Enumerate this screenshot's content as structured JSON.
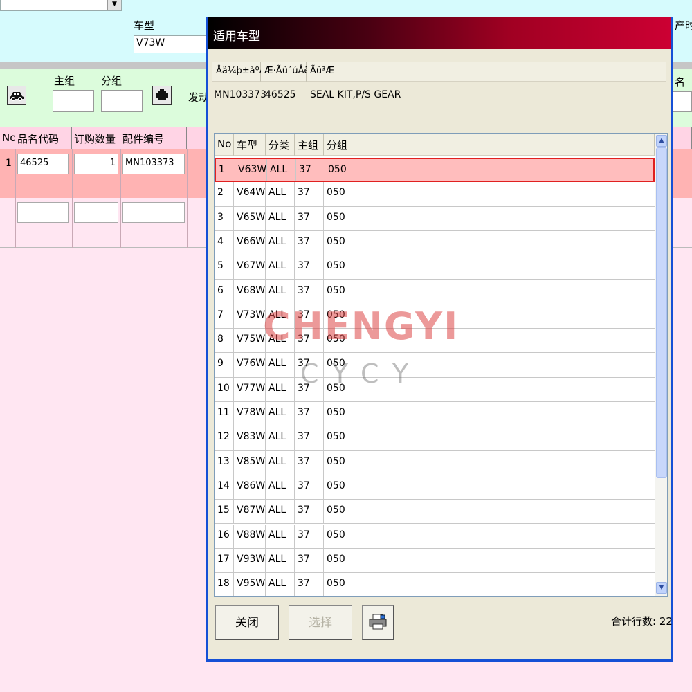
{
  "main": {
    "model_label": "车型",
    "model_value": "V73W",
    "prod_label_partial": "产时",
    "main_group_label": "主组",
    "sub_group_label": "分组",
    "engine_label_partial": "发动",
    "name_label_partial": "名",
    "grid": {
      "headers": [
        "No",
        "品名代码",
        "订购数量",
        "配件编号"
      ],
      "row": {
        "no": "1",
        "code": "46525",
        "qty": "1",
        "part": "MN103373"
      }
    }
  },
  "dialog": {
    "title": "适用车型",
    "info_headers": [
      "Åä¼þ±àºÅ",
      "Æ·Ãû´úÂë",
      "Ãû³Æ"
    ],
    "info_values": {
      "part_no": "MN103373",
      "code": "46525",
      "name": "SEAL KIT,P/S GEAR"
    },
    "list_headers": [
      "No",
      "车型",
      "分类",
      "主组",
      "分组"
    ],
    "rows": [
      {
        "no": "1",
        "model": "V63W",
        "cls": "ALL",
        "main": "37",
        "sub": "050"
      },
      {
        "no": "2",
        "model": "V64W",
        "cls": "ALL",
        "main": "37",
        "sub": "050"
      },
      {
        "no": "3",
        "model": "V65W",
        "cls": "ALL",
        "main": "37",
        "sub": "050"
      },
      {
        "no": "4",
        "model": "V66W",
        "cls": "ALL",
        "main": "37",
        "sub": "050"
      },
      {
        "no": "5",
        "model": "V67W",
        "cls": "ALL",
        "main": "37",
        "sub": "050"
      },
      {
        "no": "6",
        "model": "V68W",
        "cls": "ALL",
        "main": "37",
        "sub": "050"
      },
      {
        "no": "7",
        "model": "V73W",
        "cls": "ALL",
        "main": "37",
        "sub": "050"
      },
      {
        "no": "8",
        "model": "V75W",
        "cls": "ALL",
        "main": "37",
        "sub": "050"
      },
      {
        "no": "9",
        "model": "V76W",
        "cls": "ALL",
        "main": "37",
        "sub": "050"
      },
      {
        "no": "10",
        "model": "V77W",
        "cls": "ALL",
        "main": "37",
        "sub": "050"
      },
      {
        "no": "11",
        "model": "V78W",
        "cls": "ALL",
        "main": "37",
        "sub": "050"
      },
      {
        "no": "12",
        "model": "V83W",
        "cls": "ALL",
        "main": "37",
        "sub": "050"
      },
      {
        "no": "13",
        "model": "V85W",
        "cls": "ALL",
        "main": "37",
        "sub": "050"
      },
      {
        "no": "14",
        "model": "V86W",
        "cls": "ALL",
        "main": "37",
        "sub": "050"
      },
      {
        "no": "15",
        "model": "V87W",
        "cls": "ALL",
        "main": "37",
        "sub": "050"
      },
      {
        "no": "16",
        "model": "V88W",
        "cls": "ALL",
        "main": "37",
        "sub": "050"
      },
      {
        "no": "17",
        "model": "V93W",
        "cls": "ALL",
        "main": "37",
        "sub": "050"
      },
      {
        "no": "18",
        "model": "V95W",
        "cls": "ALL",
        "main": "37",
        "sub": "050"
      }
    ],
    "selected_row": 1,
    "close_label": "关闭",
    "select_label": "选择",
    "total_label": "合计行数: 22"
  },
  "watermark": {
    "main": "CHENGYI",
    "sub": "CYCY"
  },
  "colors": {
    "title_start": "#000000",
    "title_end": "#cc0033",
    "selected_row_bg": "#ffbdbd",
    "selected_border": "#e02020"
  }
}
